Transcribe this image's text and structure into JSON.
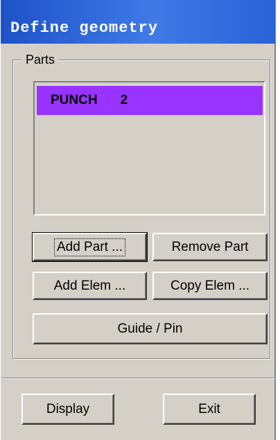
{
  "window": {
    "title": "Define geometry"
  },
  "parts_group": {
    "legend": "Parts",
    "items": [
      {
        "name": "PUNCH",
        "number": "2",
        "selected": true
      }
    ],
    "selected_color": "#9933ff"
  },
  "buttons": {
    "add_part": "Add Part ...",
    "remove_part": "Remove Part",
    "add_elem": "Add Elem ...",
    "copy_elem": "Copy Elem ...",
    "guide_pin": "Guide / Pin",
    "display": "Display",
    "exit": "Exit"
  },
  "colors": {
    "face": "#d4d0c8",
    "title_bar": "#2a62d8"
  }
}
